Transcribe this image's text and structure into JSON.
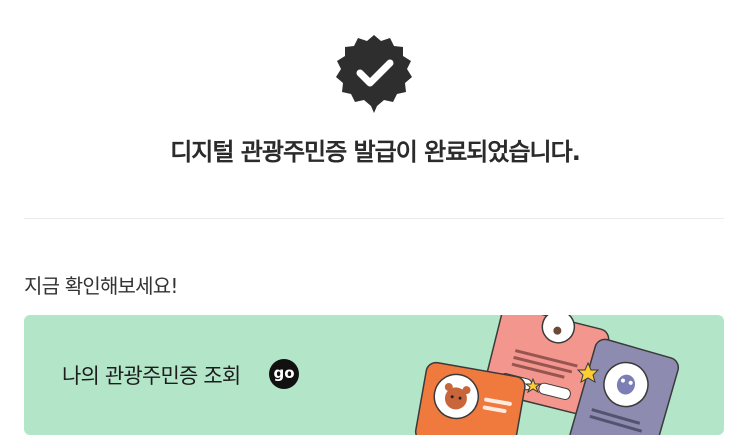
{
  "status": {
    "icon": "check-badge-icon",
    "message": "디지털 관광주민증 발급이 완료되었습니다."
  },
  "section": {
    "heading": "지금 확인해보세요!"
  },
  "banner": {
    "label": "나의 관광주민증 조회",
    "go_label": "go",
    "background": "#b3e6c9"
  },
  "colors": {
    "badge": "#2e2e2e",
    "card_orange": "#f07a3e",
    "card_pink": "#f3978e",
    "card_purple": "#8d8bb0",
    "star": "#ffcc33"
  }
}
